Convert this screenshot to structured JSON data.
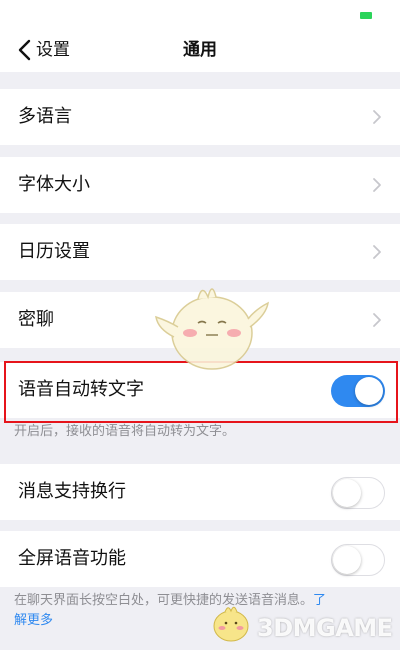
{
  "status_bar": {
    "battery_color": "#2bd45a"
  },
  "nav": {
    "back_label": "设置",
    "title": "通用"
  },
  "settings": [
    {
      "label": "多语言",
      "control": "chevron"
    },
    {
      "label": "字体大小",
      "control": "chevron"
    },
    {
      "label": "日历设置",
      "control": "chevron"
    },
    {
      "label": "密聊",
      "control": "chevron"
    },
    {
      "label": "语音自动转文字",
      "control": "toggle",
      "enabled": true
    },
    {
      "label": "消息支持换行",
      "control": "toggle",
      "enabled": false
    },
    {
      "label": "全屏语音功能",
      "control": "toggle",
      "enabled": false
    }
  ],
  "hints": {
    "voice_to_text": "开启后，接收的语音将自动转为文字。",
    "fullscreen_voice_prefix": "在聊天界面长按空白处，可更快捷的发送语音消息。",
    "learn_more_head": "了",
    "learn_more_tail": "解更多"
  },
  "colors": {
    "accent": "#2f89f0",
    "highlight_border": "#e6141b",
    "page_background": "#efeff4"
  },
  "watermark": {
    "text": "3DMGAME"
  }
}
